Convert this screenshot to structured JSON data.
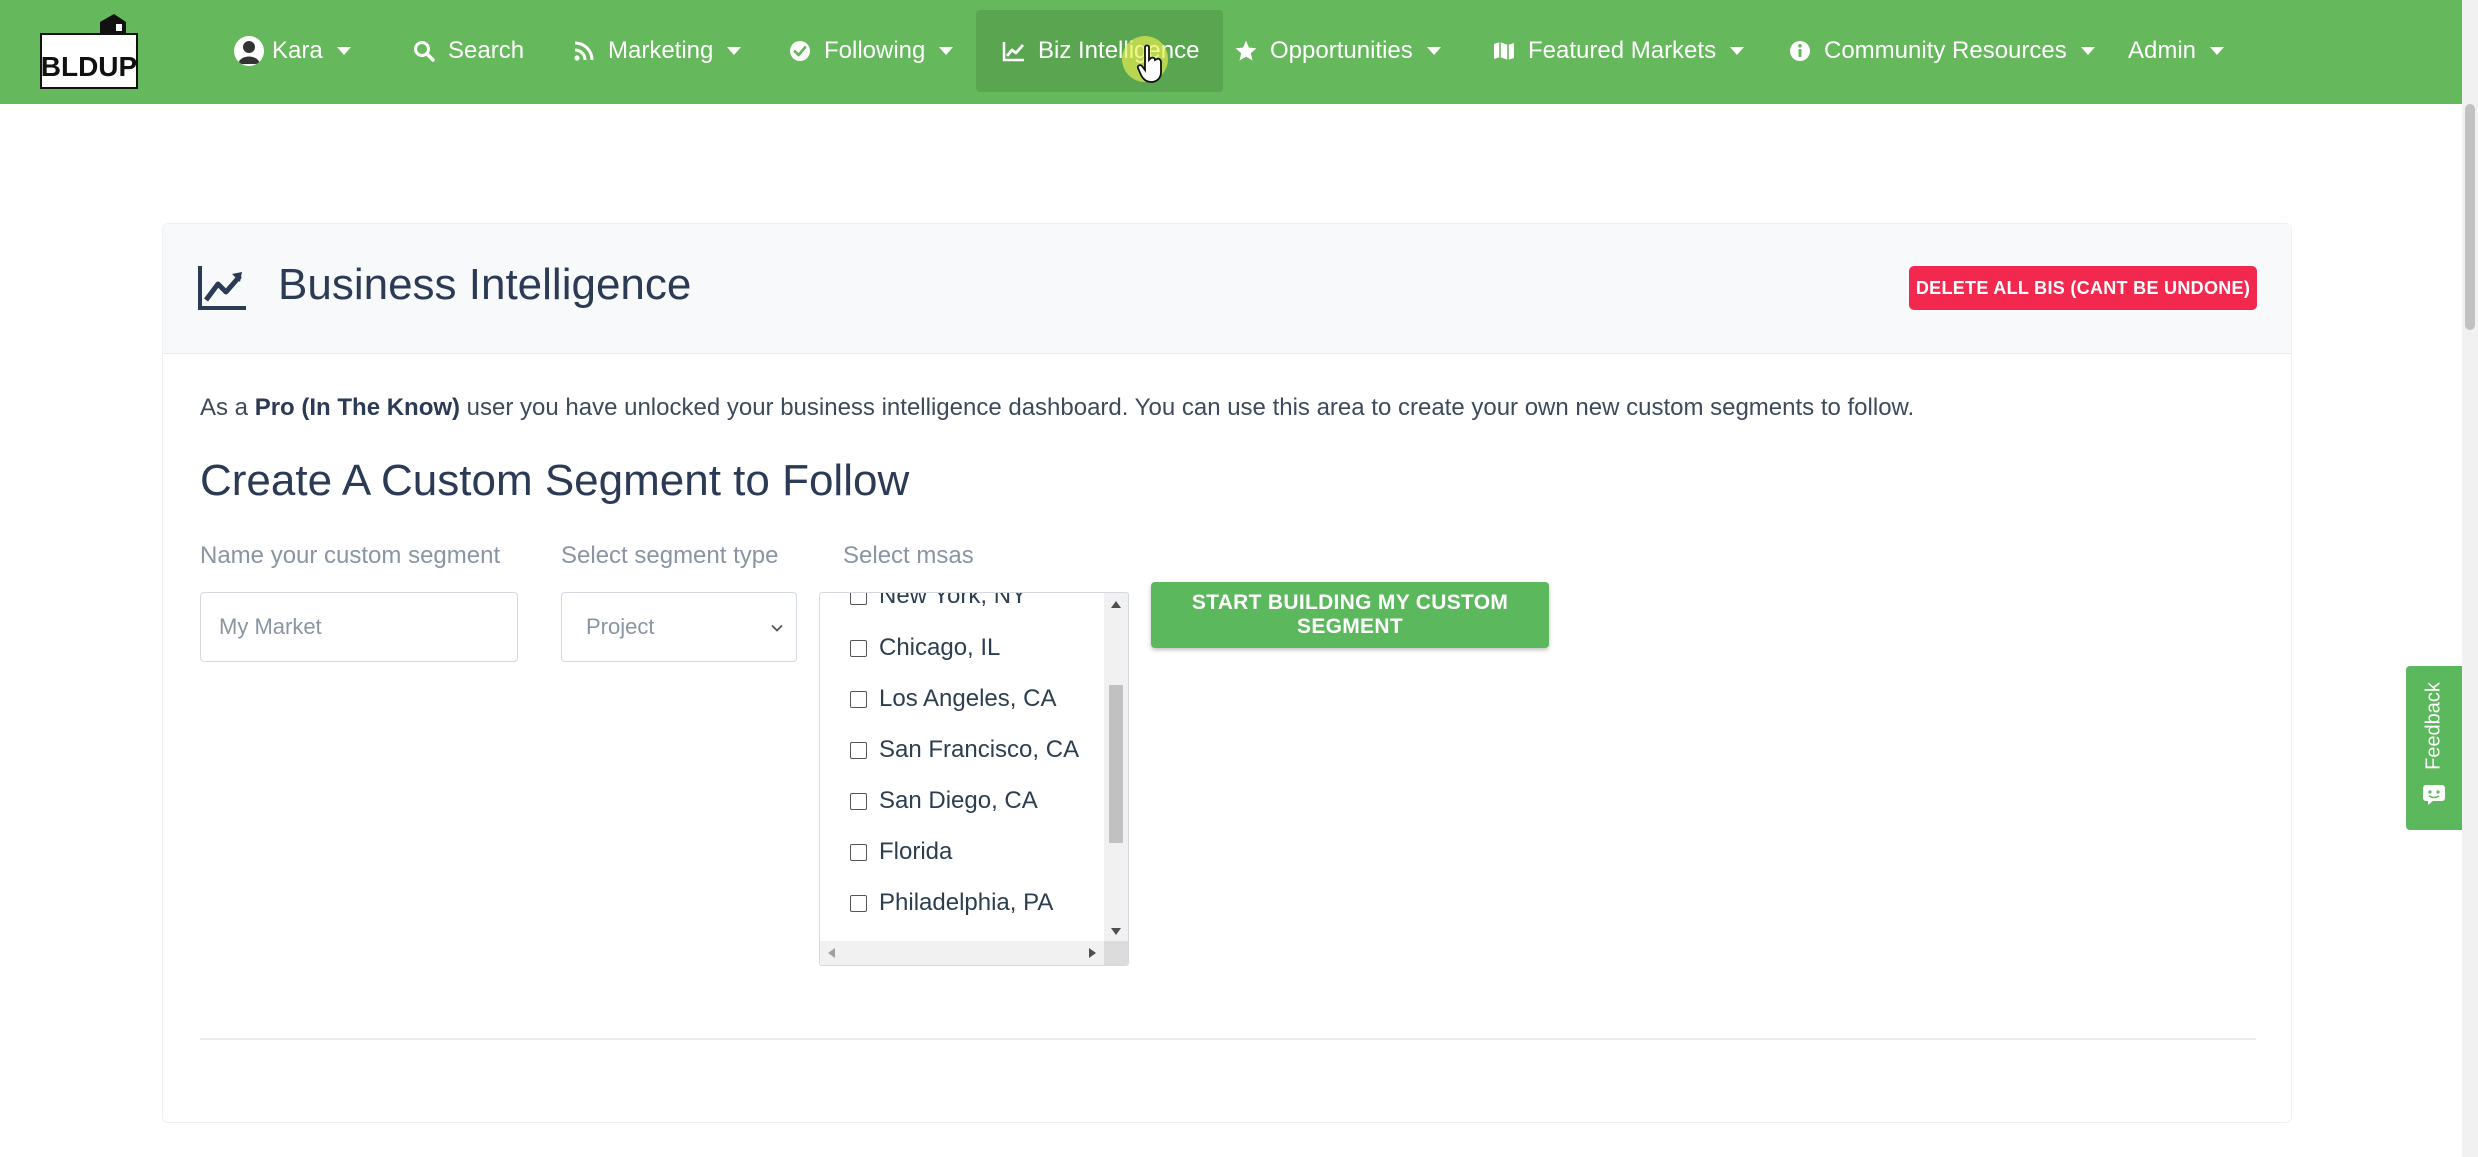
{
  "brand": {
    "logo_text": "BLDUP"
  },
  "nav": {
    "items": [
      {
        "label": "Kara",
        "icon": "user-avatar-icon",
        "has_caret": true
      },
      {
        "label": "Search",
        "icon": "search-icon",
        "has_caret": false
      },
      {
        "label": "Marketing",
        "icon": "rss-icon",
        "has_caret": true
      },
      {
        "label": "Following",
        "icon": "check-circle-icon",
        "has_caret": true
      },
      {
        "label": "Biz Intelligence",
        "icon": "line-chart-icon",
        "has_caret": false,
        "active": true
      },
      {
        "label": "Opportunities",
        "icon": "star-icon",
        "has_caret": true
      },
      {
        "label": "Featured Markets",
        "icon": "map-icon",
        "has_caret": true
      },
      {
        "label": "Community Resources",
        "icon": "info-circle-icon",
        "has_caret": true
      },
      {
        "label": "Admin",
        "icon": "",
        "has_caret": true
      }
    ]
  },
  "page": {
    "title": "Business Intelligence",
    "delete_button": "DELETE ALL BIS (CANT BE UNDONE)",
    "intro_prefix": "As a ",
    "intro_plan": "Pro (In The Know)",
    "intro_suffix": " user you have unlocked your business intelligence dashboard. You can use this area to create your own new custom segments to follow.",
    "section_title": "Create A Custom Segment to Follow"
  },
  "form": {
    "name_label": "Name your custom segment",
    "name_placeholder": "My Market",
    "type_label": "Select segment type",
    "type_value": "Project",
    "msas_label": "Select msas",
    "msas": [
      "New York, NY",
      "Chicago, IL",
      "Los Angeles, CA",
      "San Francisco, CA",
      "San Diego, CA",
      "Florida",
      "Philadelphia, PA"
    ],
    "submit_label": "START BUILDING MY CUSTOM SEGMENT"
  },
  "feedback": {
    "label": "Feedback"
  },
  "colors": {
    "nav_green": "#66b85c",
    "danger": "#f3284f",
    "button_green": "#5cb85c",
    "heading": "#2b3a55"
  }
}
